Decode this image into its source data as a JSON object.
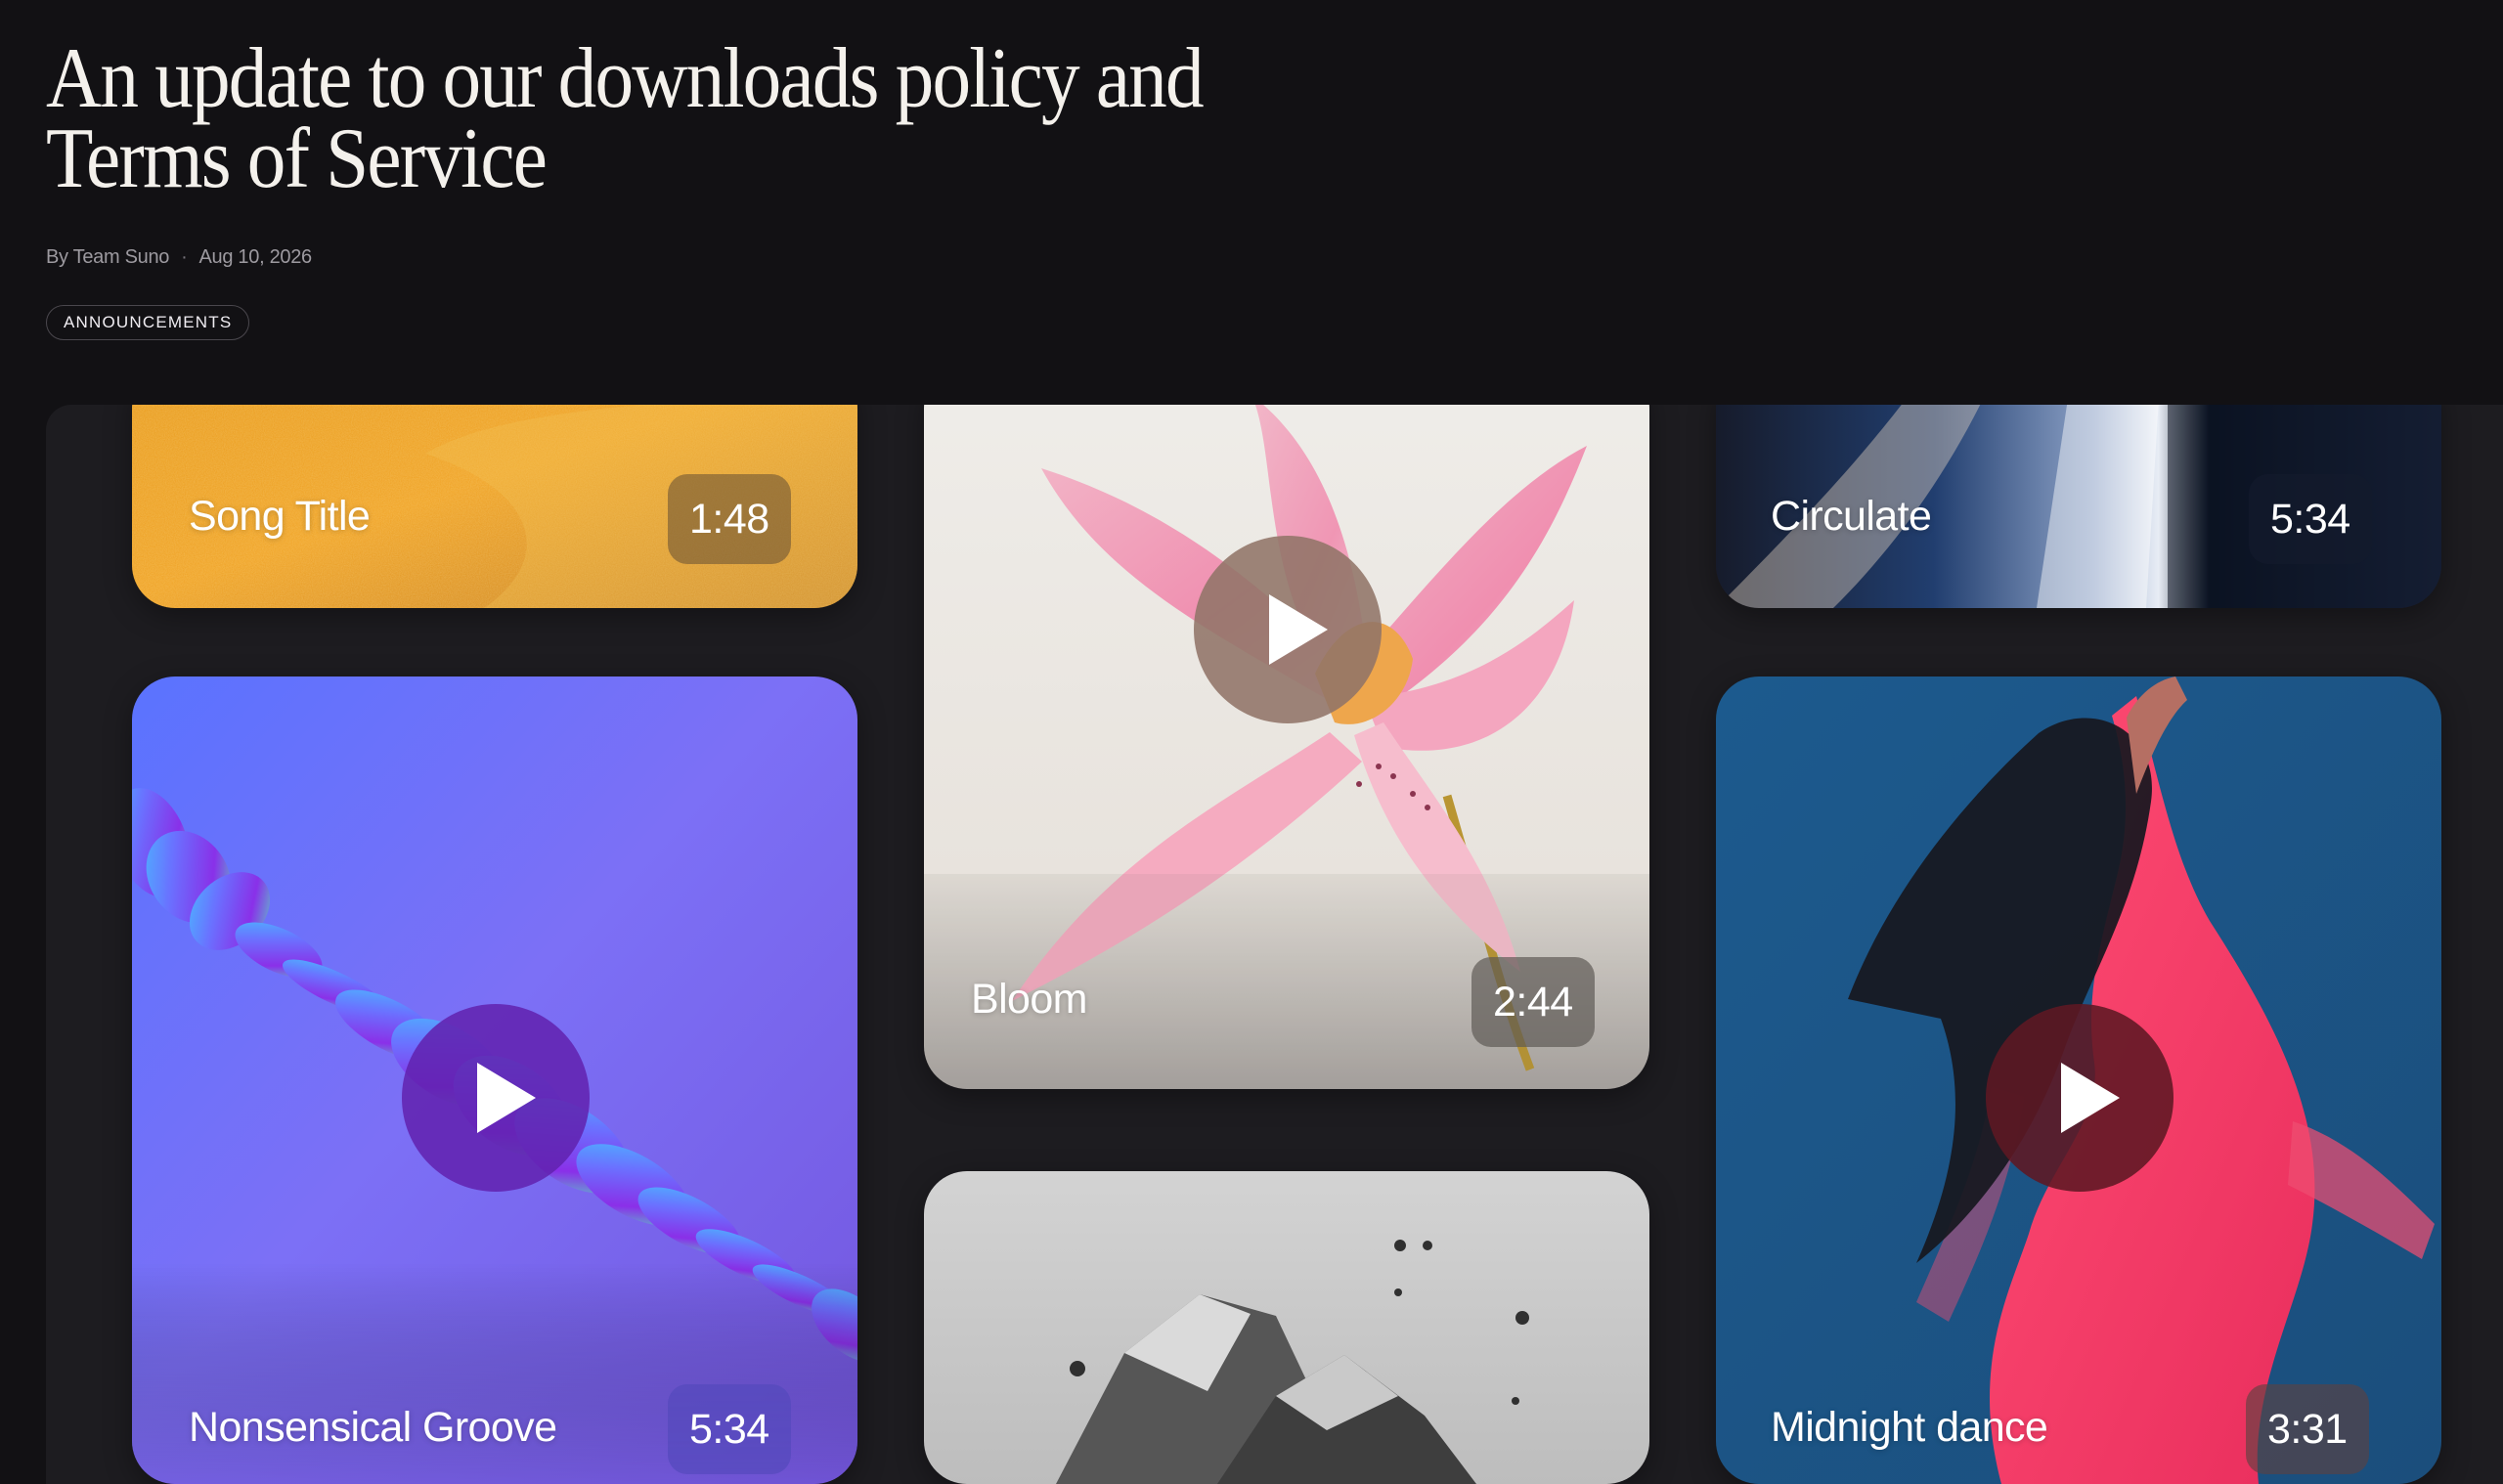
{
  "article": {
    "title": "An update to our downloads policy and Terms of Service",
    "byline": "By Team Suno",
    "separator": "·",
    "date": "Aug 10, 2026",
    "tag": "ANNOUNCEMENTS"
  },
  "cards": [
    {
      "title": "Song Title",
      "duration": "1:48"
    },
    {
      "title": "Nonsensical Groove",
      "duration": "5:34"
    },
    {
      "title": "Bloom",
      "duration": "2:44"
    },
    {
      "title": "Circulate",
      "duration": "5:34"
    },
    {
      "title": "Midnight dance",
      "duration": "3:31"
    }
  ],
  "icons": {
    "play": "play-icon"
  },
  "colors": {
    "background": "#121114",
    "gallery": "#1d1c20",
    "text": "#f4f1ec",
    "muted": "#9d9aa0"
  }
}
